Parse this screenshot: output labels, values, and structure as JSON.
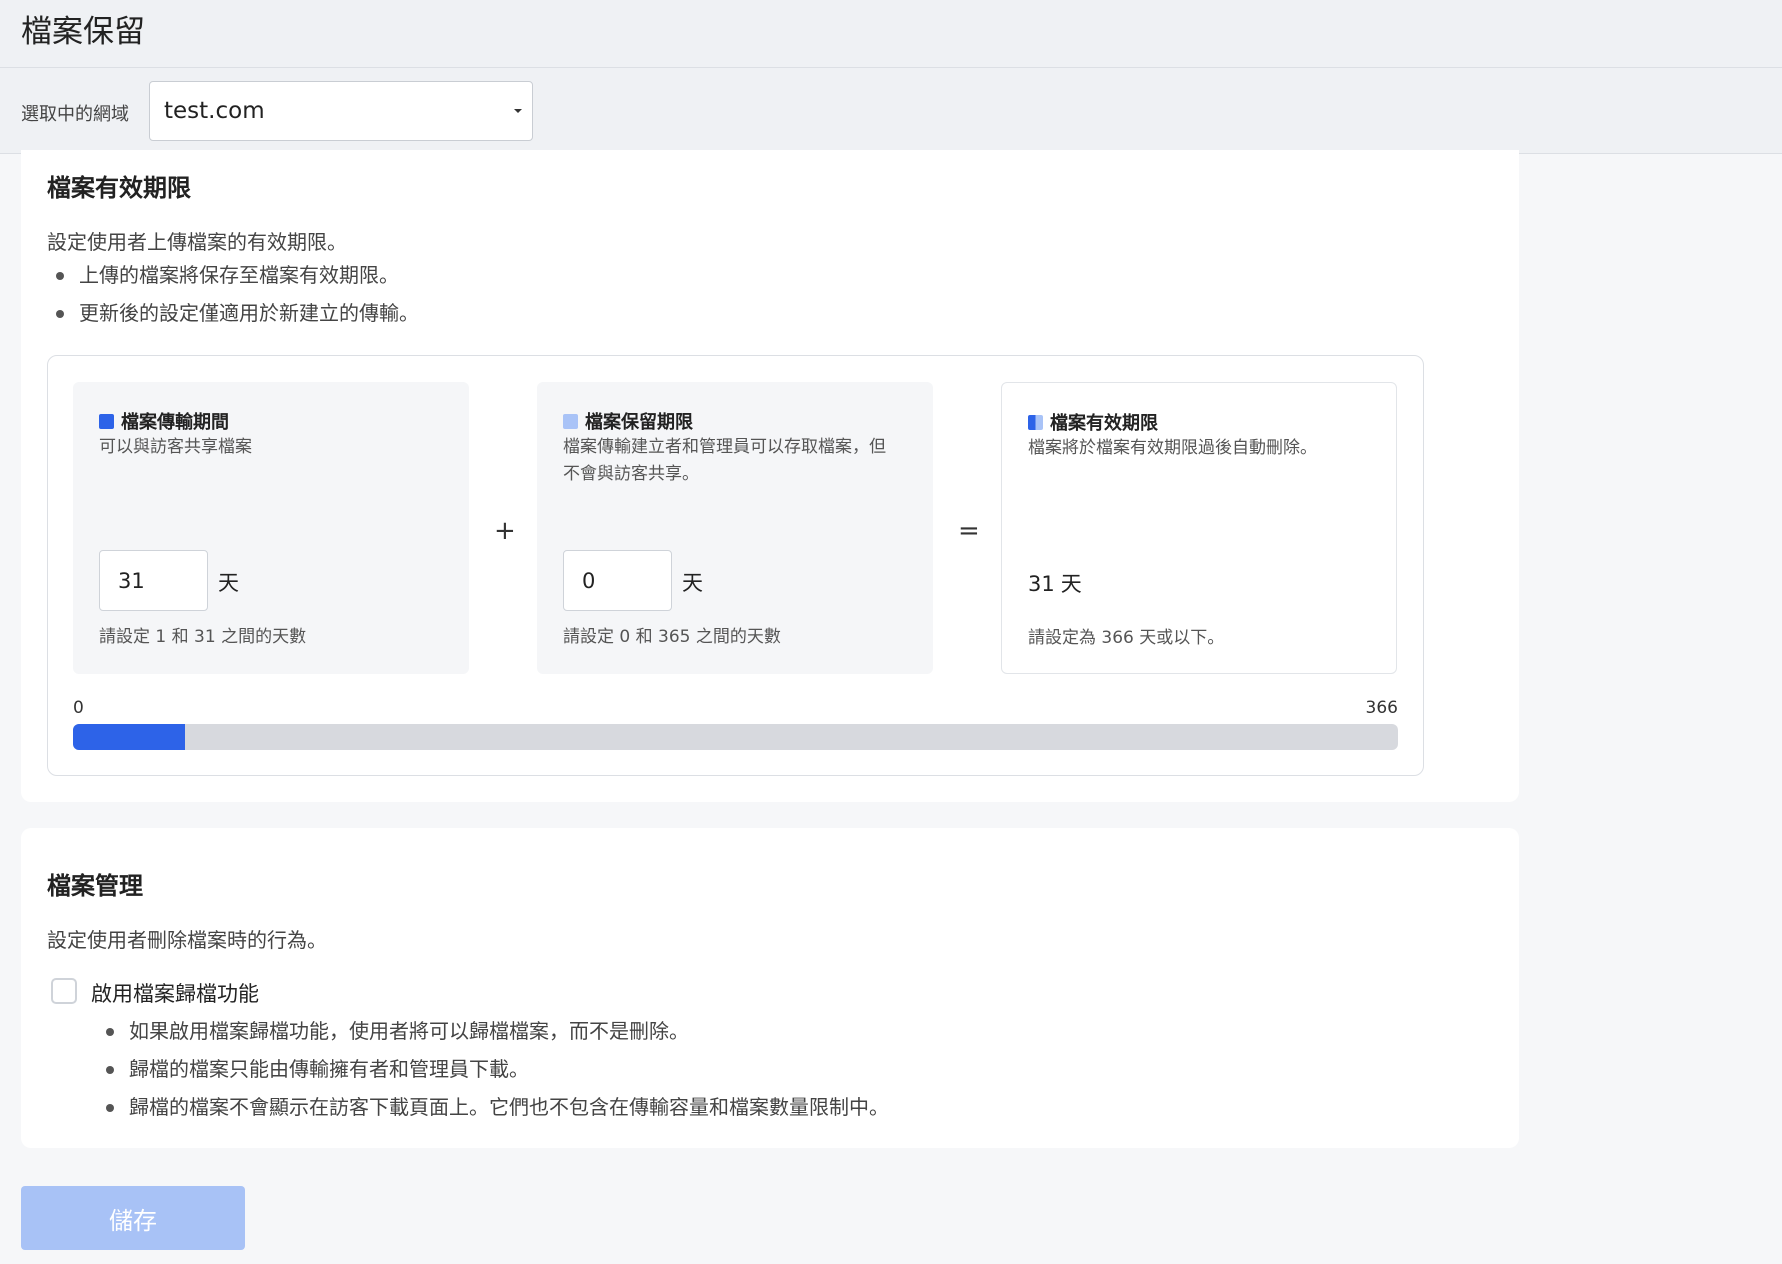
{
  "header": {
    "title": "檔案保留",
    "domain_label": "選取中的網域",
    "domain_value": "test.com"
  },
  "expiration": {
    "title": "檔案有效期限",
    "description": "設定使用者上傳檔案的有效期限。",
    "bullets": [
      "上傳的檔案將保存至檔案有效期限。",
      "更新後的設定僅適用於新建立的傳輸。"
    ],
    "transfer_period": {
      "title": "檔案傳輸期間",
      "description": "可以與訪客共享檔案",
      "value": "31",
      "unit": "天",
      "hint": "請設定 1 和 31 之間的天數"
    },
    "plus_sign": "+",
    "retention_period": {
      "title": "檔案保留期限",
      "description": "檔案傳輸建立者和管理員可以存取檔案，但不會與訪客共享。",
      "value": "0",
      "unit": "天",
      "hint": "請設定 0 和 365 之間的天數"
    },
    "equals_sign": "=",
    "total": {
      "title": "檔案有效期限",
      "description": "檔案將於檔案有效期限過後自動刪除。",
      "value": "31",
      "unit": "天",
      "hint": "請設定為 366 天或以下。"
    },
    "progress": {
      "min_label": "0",
      "max_label": "366",
      "transfer_days": 31,
      "retention_days": 0,
      "max_days": 366
    }
  },
  "management": {
    "title": "檔案管理",
    "description": "設定使用者刪除檔案時的行為。",
    "archive_checkbox_label": "啟用檔案歸檔功能",
    "archive_checked": false,
    "bullets": [
      "如果啟用檔案歸檔功能，使用者將可以歸檔檔案，而不是刪除。",
      "歸檔的檔案只能由傳輸擁有者和管理員下載。",
      "歸檔的檔案不會顯示在訪客下載頁面上。它們也不包含在傳輸容量和檔案數量限制中。"
    ]
  },
  "save_label": "儲存",
  "colors": {
    "accent": "#2d63e8",
    "accent_light": "#a9c3f7",
    "track": "#d7d9de"
  }
}
